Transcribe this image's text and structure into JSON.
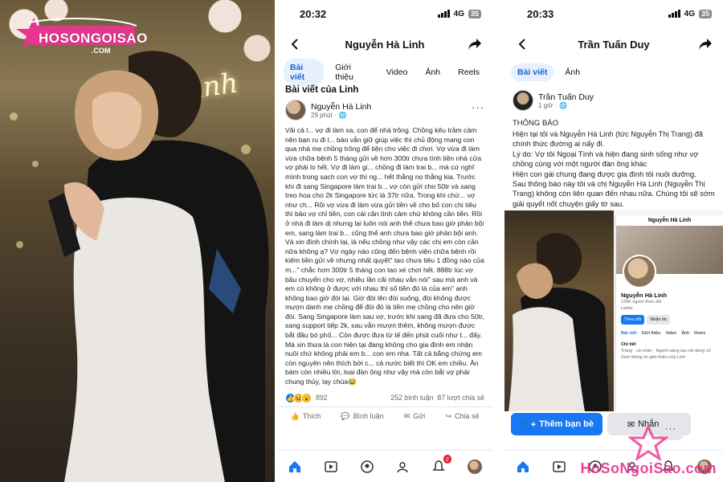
{
  "photo": {
    "brand_text": "HOSONGOISAO",
    "brand_sub": ".COM",
    "neon_text": "Anh"
  },
  "left_phone": {
    "status": {
      "time": "20:32",
      "network": "4G",
      "battery": "35"
    },
    "title": "Nguyễn Hà Linh",
    "tabs": [
      "Bài viết",
      "Giới thiệu",
      "Video",
      "Ảnh",
      "Reels"
    ],
    "active_tab": 0,
    "section_heading": "Bài viết của Linh",
    "post": {
      "author": "Nguyễn Hà Linh",
      "time": "29 phút ·",
      "body": "Vãi cả l... vợ đi làm xa, con để nhà trông. Chồng kêu trầm cảm nên bạn ru đi l... bảo vẫn giữ giúp việc thì chủ động mang con qua nhà mẹ chồng trông để tiện cho việc đi chơi. Vợ vừa đi làm vừa chữa bệnh 5 tháng gửi về hơn 300tr chưa tính tiền nhà cửa vợ phải lo hết. Vợ đi làm gi... chồng đi làm trai b... mà cứ nghĩ mình trong sạch con vợ thì ng... hết thằng nọ thằng kia. Trước khi đi sang Singapore làm trai b... vợ còn gửi cho 50tr và sang treo hoa cho 2k Singapore tức là 37tr nữa. Trong khi chứ... vợ như ch... Rồi vợ vừa đi làm vừa gửi tiền về cho bố con chi tiêu thì bảo vợ chỉ tiền, con cái cần tình cảm chứ không cần tiền. Rồi ở nhà đi làm dị nhưng lại luôn nói anh thế chưa bao giờ phản bội em, sang làm trai b... cũng thế anh chưa bao giờ phản bội anh. Và xin đính chính lại, là nếu chồng như vậy các chị em còn cần nữa không ạ? Vợ ngày nào cũng đến bệnh viện chữa bệnh rồi kiếm tiền gửi về nhưng nhất quyết\" tao chưa tiêu 1 đồng nào của m...\" chắc hơn 300tr 5 tháng con tao xé chơi hết. 888tr lúc vợ bầu chuyển cho vợ, nhiều lần cãi nhau vẫn nói\" sau mà anh và em có không ở được với nhau thì số tiền đó là của em\" anh không bao giờ đòi lại. Giờ đòi lên đòi xuống, đòi không được mượn danh mẹ chồng để đòi đó là tiền mẹ chồng cho nên giờ đòi. Sang Singapore làm sau vợ, trước khi sang đã đưa cho 50tr, sang support tiếp 2k, sau vẫn mượn thêm, không mượn được bắt đầu bó phố... Còn được đưa từ tế đến phút cuối như t... đấy. Mà xin thưa là con hiện tại đang không cho gia đình em nhận nuôi chứ không phải em b... con em nha. Tất cả bằng chứng em còn nguyên nên thích bới c... cả nước biết thì OK em chiều. Ăn bám còn nhiều lời, loại đàn ông như vậy mà còn bắt vợ phải chung thủy, lạy chúa😂",
      "reaction_count": "892",
      "comments": "252 bình luận",
      "shares": "87 lượt chia sẻ",
      "actions": [
        "Thích",
        "Bình luận",
        "Gửi",
        "Chia sẻ"
      ]
    },
    "notif_count": "2"
  },
  "right_phone": {
    "status": {
      "time": "20:33",
      "network": "4G",
      "battery": "35"
    },
    "title": "Trần Tuấn Duy",
    "tabs": [
      "Bài viết",
      "Ảnh"
    ],
    "active_tab": 0,
    "post": {
      "author": "Trần Tuấn Duy",
      "time": "1 giờ ·",
      "heading": "THÔNG BÁO",
      "body": "Hiện tại tôi và Nguyễn Hà Linh (tức Nguyễn Thị Trang) đã chính thức đường ai nấy đi.\nLý do: Vợ tôi Ngoại Tình và hiện đang sinh sống như vợ chồng cùng với một người đàn ông khác\nHiện con gái chung đang được gia đình tôi nuôi dưỡng.\nSau thông báo này tôi và chị Nguyễn Hà Linh (Nguyễn Thị Trang) không còn liên quan đến nhau nữa. Chúng tôi sẽ sớm giải quyết nốt chuyện giấy tờ sau.\nTrân trọng."
    },
    "screenshot": {
      "title": "Nguyễn Hà Linh",
      "name": "Nguyễn Hà Linh",
      "followers": "135K người theo dõi",
      "bio": "Lanlie",
      "follow_btn": "Theo dõi",
      "message_btn": "Nhắn tin",
      "tabs": [
        "Bài viết",
        "Giới thiệu",
        "Video",
        "Ảnh",
        "Reels"
      ],
      "detail_heading": "Chi tiết",
      "detail_line1": "Trang · cá nhân · Người sáng tạo nội dung số",
      "detail_line2": "Xem thông tin giới thiệu của Linh"
    },
    "buttons": {
      "add_friend": "Thêm bạn bè",
      "message": "Nhắn tin",
      "more": "···"
    },
    "watermark": "HoSoNgoiSao.com"
  },
  "colors": {
    "fb_blue": "#1877f2",
    "tab_active_bg": "#e7f0fd",
    "brand_pink": "#e8368f"
  }
}
